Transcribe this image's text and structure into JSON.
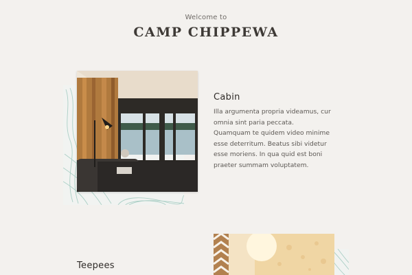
{
  "header": {
    "welcome": "Welcome to",
    "title": "CAMP CHIPPEWA"
  },
  "sections": [
    {
      "title": "Cabin",
      "body": "Illa argumenta propria videamus, cur omnia sint paria peccata. Quamquam te quidem video minime esse deterritum. Beatus sibi videtur esse moriens. In qua quid est boni praeter summam voluptatem.",
      "image_icon": "cabin-photo"
    },
    {
      "title": "Teepees",
      "image_icon": "teepee-photo"
    }
  ],
  "colors": {
    "background": "#f3f1ee",
    "topo_lines": "#9fc9be",
    "text": "#3e3a36"
  }
}
